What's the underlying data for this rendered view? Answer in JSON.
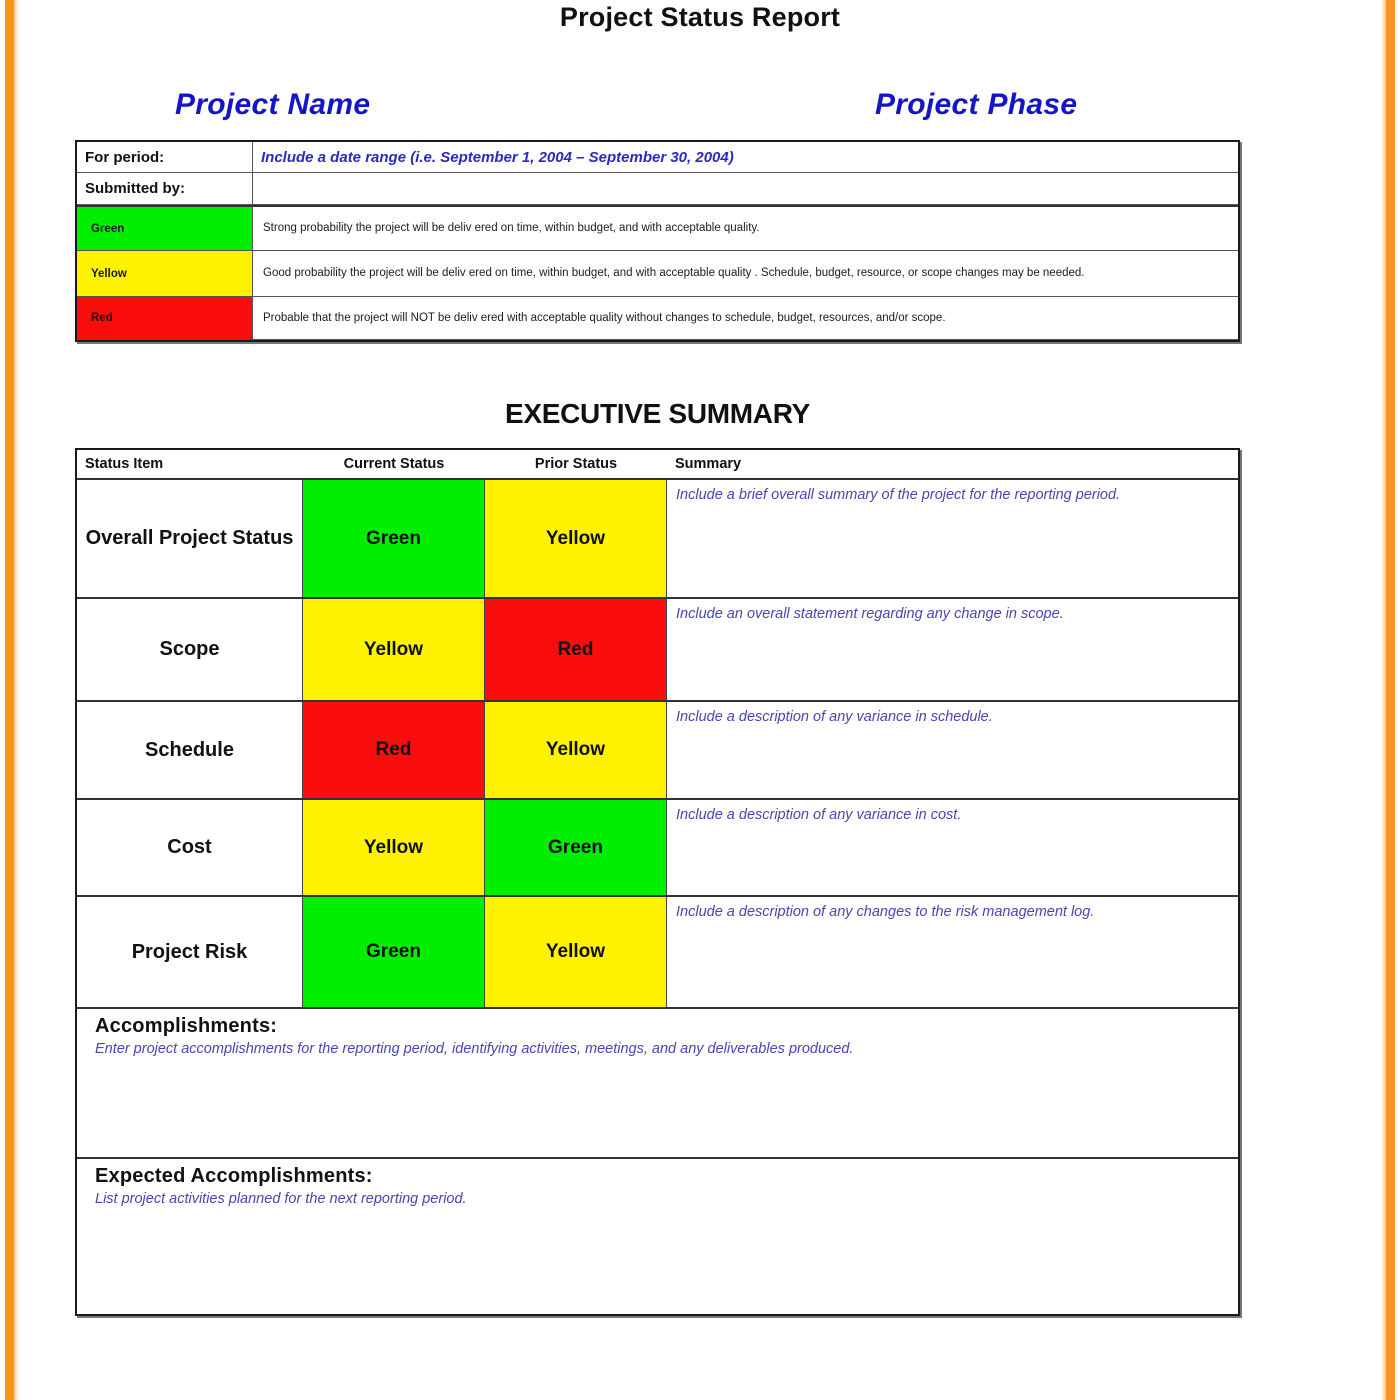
{
  "document": {
    "title": "Project Status Report",
    "project_name_heading": "Project Name",
    "project_phase_heading": "Project Phase",
    "executive_summary_heading": "EXECUTIVE SUMMARY"
  },
  "colors": {
    "green": "#00EE00",
    "yellow": "#FFF200",
    "red": "#FA0D0D",
    "heading_blue": "#1414C8",
    "placeholder_blue": "#4646B4",
    "accent_orange": "#F7941E"
  },
  "header_table": {
    "for_period_label": "For period:",
    "for_period_value": "Include a date range (i.e. September 1, 2004 – September 30, 2004)",
    "submitted_by_label": "Submitted by:",
    "submitted_by_value": "",
    "legend": [
      {
        "label": "Green",
        "color": "#00EE00",
        "description": "Strong probability  the project will be deliv ered on time, within budget, and with acceptable quality."
      },
      {
        "label": "Yellow",
        "color": "#FFF200",
        "description": "Good probability the project will be deliv ered on time, within budget, and with acceptable quality . Schedule, budget, resource, or scope changes may be needed."
      },
      {
        "label": "Red",
        "color": "#FA0D0D",
        "description": "Probable that the project will NOT be deliv ered with acceptable quality without changes to schedule, budget, resources, and/or scope."
      }
    ]
  },
  "exec_summary": {
    "columns": [
      "Status Item",
      "Current Status",
      "Prior Status",
      "Summary"
    ],
    "rows": [
      {
        "item": "Overall Project Status",
        "current": "Green",
        "current_color": "#00EE00",
        "prior": "Yellow",
        "prior_color": "#FFF200",
        "summary": "Include a brief overall summary of the project for the reporting period."
      },
      {
        "item": "Scope",
        "current": "Yellow",
        "current_color": "#FFF200",
        "prior": "Red",
        "prior_color": "#FA0D0D",
        "summary": "Include an overall statement regarding any change in scope."
      },
      {
        "item": "Schedule",
        "current": "Red",
        "current_color": "#FA0D0D",
        "prior": "Yellow",
        "prior_color": "#FFF200",
        "summary": "Include a description of any variance in schedule."
      },
      {
        "item": "Cost",
        "current": "Yellow",
        "current_color": "#FFF200",
        "prior": "Green",
        "prior_color": "#00EE00",
        "summary": "Include a description of any variance in cost."
      },
      {
        "item": "Project Risk",
        "current": "Green",
        "current_color": "#00EE00",
        "prior": "Yellow",
        "prior_color": "#FFF200",
        "summary": "Include a description of any changes to the risk management log."
      }
    ],
    "accomplishments": {
      "title": "Accomplishments:",
      "note": "Enter project accomplishments for the reporting period, identifying activities, meetings, and any deliverables produced.",
      "value": ""
    },
    "expected_accomplishments": {
      "title": "Expected Accomplishments:",
      "note": "List project activities planned for the next reporting period.",
      "value": ""
    }
  }
}
